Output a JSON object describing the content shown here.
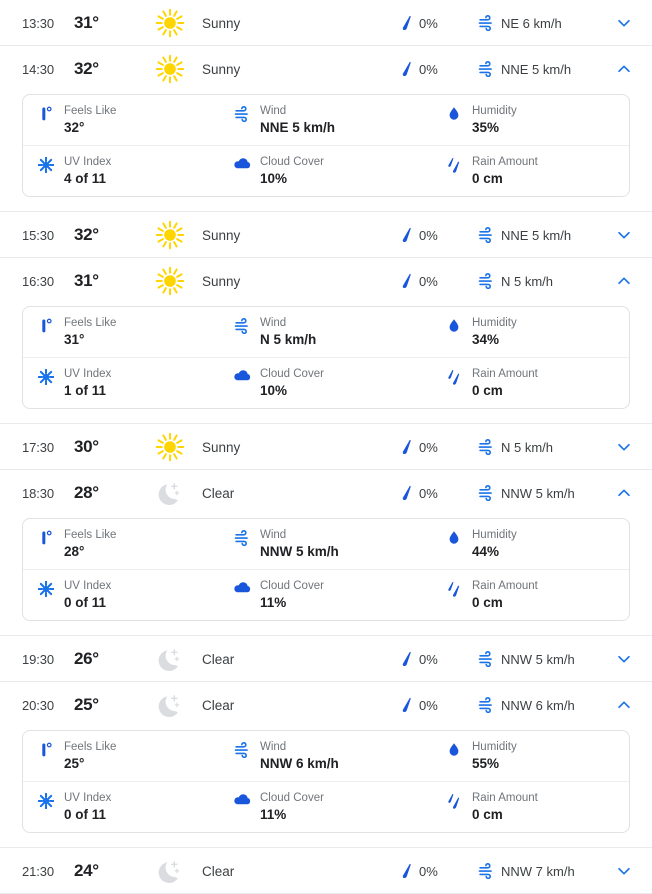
{
  "accent_colors": {
    "blue": "#1a56db",
    "blue_icon": "#1a73e8",
    "sun_yellow": "#ffd500",
    "moon_gray": "#dadce0",
    "label_gray": "#70757a",
    "text_dark": "#202124",
    "divider": "#e8eaed"
  },
  "detail_labels": {
    "feels_like": "Feels Like",
    "wind": "Wind",
    "humidity": "Humidity",
    "uv_index": "UV Index",
    "cloud_cover": "Cloud Cover",
    "rain_amount": "Rain Amount"
  },
  "icons": {
    "sunny": "sun-icon",
    "clear": "moon-icon",
    "precipitation": "raindrop-icon",
    "wind": "wind-icon",
    "expand": "chevron-down-icon",
    "collapse": "chevron-up-icon",
    "feels_like": "thermometer-icon",
    "humidity": "water-drop-icon",
    "uv_index": "sun-burst-icon",
    "cloud_cover": "cloud-icon",
    "rain_amount": "rain-drops-icon"
  },
  "hours": [
    {
      "time": "13:30",
      "temp": "31°",
      "condition": "Sunny",
      "sky": "sunny",
      "precip": "0%",
      "wind": "NE 6 km/h",
      "expanded": false
    },
    {
      "time": "14:30",
      "temp": "32°",
      "condition": "Sunny",
      "sky": "sunny",
      "precip": "0%",
      "wind": "NNE 5 km/h",
      "expanded": true,
      "details": {
        "feels_like": "32°",
        "wind": "NNE 5 km/h",
        "humidity": "35%",
        "uv_index": "4 of 11",
        "cloud_cover": "10%",
        "rain_amount": "0 cm"
      }
    },
    {
      "time": "15:30",
      "temp": "32°",
      "condition": "Sunny",
      "sky": "sunny",
      "precip": "0%",
      "wind": "NNE 5 km/h",
      "expanded": false
    },
    {
      "time": "16:30",
      "temp": "31°",
      "condition": "Sunny",
      "sky": "sunny",
      "precip": "0%",
      "wind": "N 5 km/h",
      "expanded": true,
      "details": {
        "feels_like": "31°",
        "wind": "N 5 km/h",
        "humidity": "34%",
        "uv_index": "1 of 11",
        "cloud_cover": "10%",
        "rain_amount": "0 cm"
      }
    },
    {
      "time": "17:30",
      "temp": "30°",
      "condition": "Sunny",
      "sky": "sunny",
      "precip": "0%",
      "wind": "N 5 km/h",
      "expanded": false
    },
    {
      "time": "18:30",
      "temp": "28°",
      "condition": "Clear",
      "sky": "clear",
      "precip": "0%",
      "wind": "NNW 5 km/h",
      "expanded": true,
      "details": {
        "feels_like": "28°",
        "wind": "NNW 5 km/h",
        "humidity": "44%",
        "uv_index": "0 of 11",
        "cloud_cover": "11%",
        "rain_amount": "0 cm"
      }
    },
    {
      "time": "19:30",
      "temp": "26°",
      "condition": "Clear",
      "sky": "clear",
      "precip": "0%",
      "wind": "NNW 5 km/h",
      "expanded": false
    },
    {
      "time": "20:30",
      "temp": "25°",
      "condition": "Clear",
      "sky": "clear",
      "precip": "0%",
      "wind": "NNW 6 km/h",
      "expanded": true,
      "details": {
        "feels_like": "25°",
        "wind": "NNW 6 km/h",
        "humidity": "55%",
        "uv_index": "0 of 11",
        "cloud_cover": "11%",
        "rain_amount": "0 cm"
      }
    },
    {
      "time": "21:30",
      "temp": "24°",
      "condition": "Clear",
      "sky": "clear",
      "precip": "0%",
      "wind": "NNW 7 km/h",
      "expanded": false
    }
  ]
}
